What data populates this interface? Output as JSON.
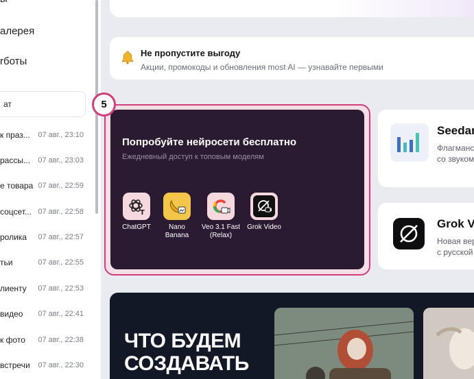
{
  "sidebar": {
    "nav": [
      "ы",
      "алерея",
      "rботы"
    ],
    "search_value": "ат",
    "chats": [
      {
        "title": "к праз...",
        "time": "07 авг., 23:10"
      },
      {
        "title": "рассы...",
        "time": "07 авг., 23:03"
      },
      {
        "title": "е товара",
        "time": "07 авг., 22:59"
      },
      {
        "title": "соцсет...",
        "time": "07 авг., 22:58"
      },
      {
        "title": "ролика",
        "time": "07 авг., 22:57"
      },
      {
        "title": "тьи",
        "time": "07 авг., 22:55"
      },
      {
        "title": "лиенту",
        "time": "07 авг., 22:53"
      },
      {
        "title": "видео",
        "time": "07 авг., 22:41"
      },
      {
        "title": "к фото",
        "time": "07 авг., 22:38"
      },
      {
        "title": "встречи",
        "time": "07 авг., 22:30"
      }
    ]
  },
  "notice": {
    "title": "Не пропустите выгоду",
    "subtitle": "Акции, промокоды и обновления most AI — узнавайте первыми",
    "icon": "bell-icon"
  },
  "step_badge": "5",
  "promo": {
    "title": "Попробуйте нейросети бесплатно",
    "subtitle": "Ежедневный доступ к топовым моделям",
    "models": [
      {
        "label": "ChatGPT",
        "icon": "chatgpt-icon"
      },
      {
        "label": "Nano Banana",
        "icon": "banana-icon"
      },
      {
        "label": "Veo 3.1 Fast (Relax)",
        "icon": "google-icon"
      },
      {
        "label": "Grok Video",
        "icon": "grok-icon"
      }
    ]
  },
  "right_cards": [
    {
      "title": "Seedar",
      "desc1": "Флагманс",
      "desc2": "со звуком"
    },
    {
      "title": "Grok Vi",
      "desc1": "Новая вер",
      "desc2": "с русской"
    }
  ],
  "banner": {
    "line1": "ЧТО БУДЕМ",
    "line2": "СОЗДАВАТЬ"
  },
  "colors": {
    "accent": "#d43c7a",
    "promo_bg": "#2b1b32",
    "banner_bg": "#121826"
  }
}
